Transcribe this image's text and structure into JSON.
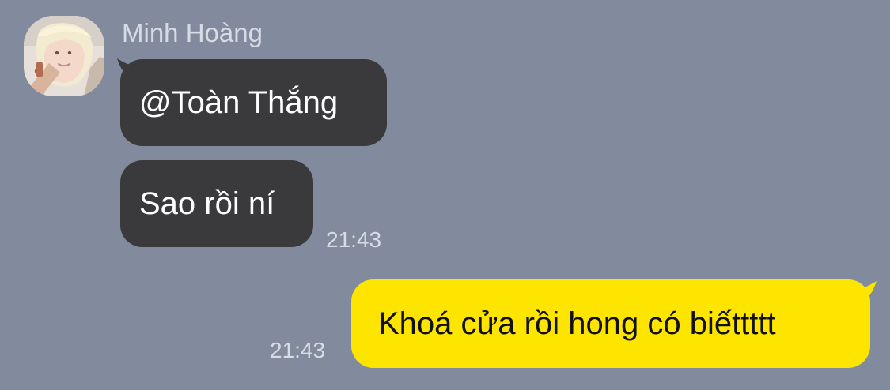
{
  "conversation": {
    "incoming": {
      "sender_name": "Minh Hoàng",
      "avatar_icon": "user-photo-avatar",
      "messages": [
        {
          "text": "@Toàn Thắng"
        },
        {
          "text": "Sao rồi ní",
          "time": "21:43"
        }
      ]
    },
    "outgoing": {
      "messages": [
        {
          "text": "Khoá cửa rồi hong có biếttttt",
          "time": "21:43"
        }
      ]
    }
  },
  "colors": {
    "background": "#828b9d",
    "incoming_bubble": "#3a3a3c",
    "outgoing_bubble": "#fee500",
    "sender_name": "#d6dbe4",
    "timestamp": "#d7dce5"
  }
}
